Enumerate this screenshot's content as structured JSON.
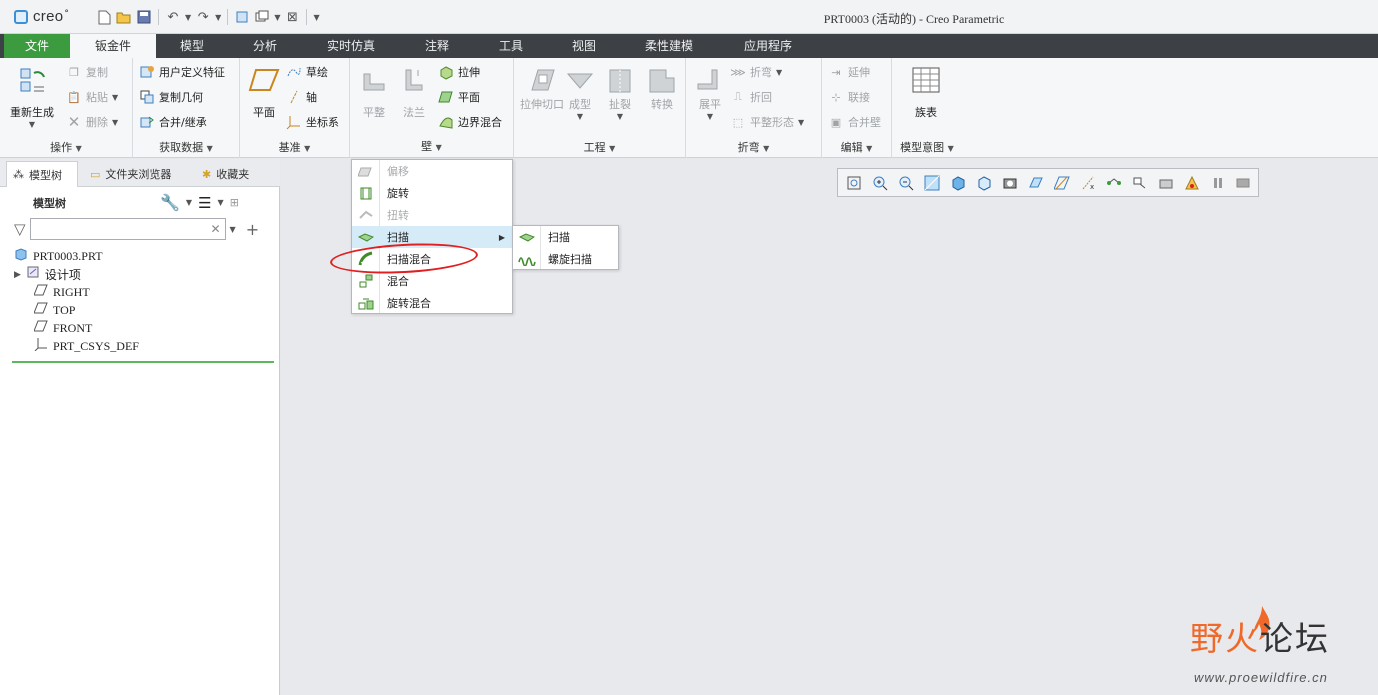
{
  "app": {
    "logo": "creo",
    "logo_mark": "°",
    "window_title": "PRT0003 (活动的) - Creo Parametric"
  },
  "quick_access": [
    "new-icon",
    "open-icon",
    "save-icon",
    "undo-icon",
    "redo-icon",
    "regenerate-icon",
    "windows-icon",
    "close-window-icon",
    "customize-icon"
  ],
  "tabs": [
    {
      "label": "文件"
    },
    {
      "label": "钣金件"
    },
    {
      "label": "模型"
    },
    {
      "label": "分析"
    },
    {
      "label": "实时仿真"
    },
    {
      "label": "注释"
    },
    {
      "label": "工具"
    },
    {
      "label": "视图"
    },
    {
      "label": "柔性建模"
    },
    {
      "label": "应用程序"
    }
  ],
  "ribbon": {
    "operations": {
      "label": "操作",
      "regen": "重新生成",
      "copy": "复制",
      "paste": "粘贴",
      "delete": "删除"
    },
    "get_data": {
      "label": "获取数据",
      "udf": "用户定义特征",
      "copy_geom": "复制几何",
      "merge": "合并/继承"
    },
    "datum": {
      "label": "基准",
      "plane": "平面",
      "sketch": "草绘",
      "axis": "轴",
      "csys": "坐标系"
    },
    "wall": {
      "label": "壁",
      "flat": "平整",
      "flange": "法兰",
      "extrude": "拉伸",
      "planar": "平面",
      "boundary_blend": "边界混合"
    },
    "engineering": {
      "label": "工程",
      "extrude_cut": "拉伸切口",
      "form": "成型",
      "rip": "扯裂",
      "convert": "转换"
    },
    "bend": {
      "label": "折弯",
      "unbend": "展平",
      "bend": "折弯",
      "bend_back": "折回",
      "flat_pattern": "平整形态"
    },
    "editing": {
      "label": "编辑",
      "extend": "延伸",
      "join": "联接",
      "merge_wall": "合并壁"
    },
    "model_intent": {
      "label": "模型意图",
      "family_table": "族表"
    }
  },
  "left_panel": {
    "tabs": {
      "model_tree": "模型树",
      "folder_browser": "文件夹浏览器",
      "favorites": "收藏夹"
    },
    "tree_title": "模型树",
    "search_value": "",
    "items": [
      "PRT0003.PRT",
      "设计项",
      "RIGHT",
      "TOP",
      "FRONT",
      "PRT_CSYS_DEF"
    ]
  },
  "wall_menu": {
    "items": [
      {
        "label": "偏移",
        "icon": "offset-icon",
        "enabled": false
      },
      {
        "label": "旋转",
        "icon": "revolve-icon",
        "enabled": true
      },
      {
        "label": "扭转",
        "icon": "twist-icon",
        "enabled": false
      },
      {
        "label": "扫描",
        "icon": "sweep-icon",
        "enabled": true
      },
      {
        "label": "扫描混合",
        "icon": "swept-blend-icon",
        "enabled": true
      },
      {
        "label": "混合",
        "icon": "blend-icon",
        "enabled": true
      },
      {
        "label": "旋转混合",
        "icon": "rotational-blend-icon",
        "enabled": true
      }
    ],
    "submenu": [
      {
        "label": "扫描",
        "icon": "sweep-icon"
      },
      {
        "label": "螺旋扫描",
        "icon": "helical-sweep-icon"
      }
    ]
  },
  "view_toolbar": [
    "refit-icon",
    "zoom-in-icon",
    "zoom-out-icon",
    "repaint-icon",
    "display-style-icon",
    "saved-views-icon",
    "view-manager-icon",
    "perspective-icon",
    "plane-display-icon",
    "axis-display-icon",
    "point-display-icon",
    "csys-display-icon",
    "annotation-display-icon",
    "spin-center-icon",
    "pause-icon",
    "next-icon"
  ],
  "watermark": {
    "cn_a": "野火",
    "cn_b": "论坛",
    "url": "www.proewildfire.cn"
  },
  "colors": {
    "file_tab": "#3c9b3f",
    "tabbar": "#3d4044",
    "highlight": "#d6ebf8",
    "annotation": "#e02020",
    "watermark": "#ef6a2a"
  }
}
